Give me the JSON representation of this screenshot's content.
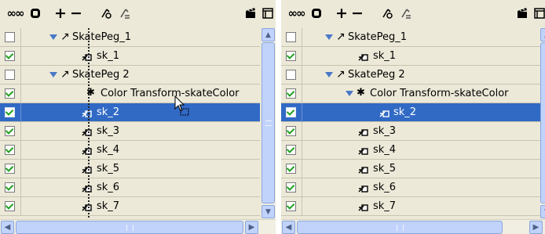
{
  "toolbar": {
    "icons": [
      "glasses-icon",
      "ring-icon",
      "plus-icon",
      "minus-icon",
      "add-peg-icon",
      "remove-peg-icon",
      "clapper-icon",
      "panel-icon"
    ],
    "glyphs": {
      "glasses": "∞∞",
      "plus": "+",
      "minus": "−"
    }
  },
  "left_panel": {
    "rows": [
      {
        "checked": false,
        "label": "SkatePeg_1",
        "kind": "peg",
        "selected": false
      },
      {
        "checked": true,
        "label": "sk_1",
        "kind": "drawing",
        "selected": false
      },
      {
        "checked": false,
        "label": "SkatePeg 2",
        "kind": "peg",
        "selected": false
      },
      {
        "checked": true,
        "label": "Color Transform-skateColor",
        "kind": "transform",
        "selected": false
      },
      {
        "checked": true,
        "label": "sk_2",
        "kind": "drawing",
        "selected": true
      },
      {
        "checked": true,
        "label": "sk_3",
        "kind": "drawing",
        "selected": false
      },
      {
        "checked": true,
        "label": "sk_4",
        "kind": "drawing",
        "selected": false
      },
      {
        "checked": true,
        "label": "sk_5",
        "kind": "drawing",
        "selected": false
      },
      {
        "checked": true,
        "label": "sk_6",
        "kind": "drawing",
        "selected": false
      },
      {
        "checked": true,
        "label": "sk_7",
        "kind": "drawing",
        "selected": false
      }
    ]
  },
  "right_panel": {
    "rows": [
      {
        "checked": false,
        "label": "SkatePeg_1",
        "kind": "peg",
        "selected": false
      },
      {
        "checked": true,
        "label": "sk_1",
        "kind": "drawing",
        "selected": false
      },
      {
        "checked": false,
        "label": "SkatePeg 2",
        "kind": "peg",
        "selected": false
      },
      {
        "checked": true,
        "label": "Color Transform-skateColor",
        "kind": "transform",
        "selected": false
      },
      {
        "checked": true,
        "label": "sk_2",
        "kind": "drawing",
        "selected": true
      },
      {
        "checked": true,
        "label": "sk_3",
        "kind": "drawing",
        "selected": false
      },
      {
        "checked": true,
        "label": "sk_4",
        "kind": "drawing",
        "selected": false
      },
      {
        "checked": true,
        "label": "sk_5",
        "kind": "drawing",
        "selected": false
      },
      {
        "checked": true,
        "label": "sk_6",
        "kind": "drawing",
        "selected": false
      },
      {
        "checked": true,
        "label": "sk_7",
        "kind": "drawing",
        "selected": false
      }
    ]
  },
  "colors": {
    "panel_bg": "#ece9d8",
    "selection": "#316ac5",
    "triangle": "#4a78c8",
    "check": "#21a121",
    "scroll": "#c1d3fb"
  }
}
